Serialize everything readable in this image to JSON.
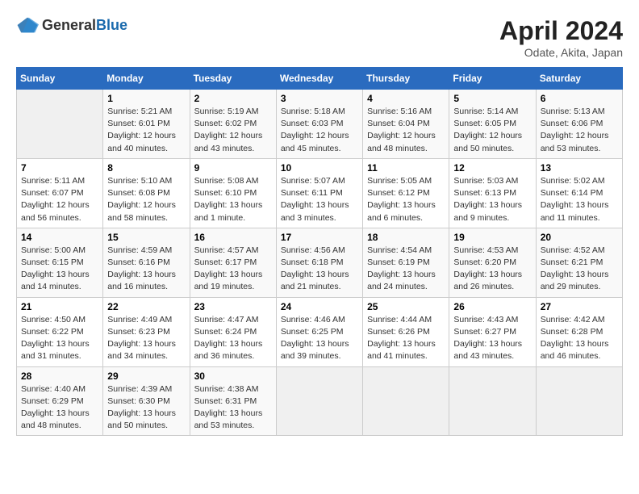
{
  "logo": {
    "text_general": "General",
    "text_blue": "Blue"
  },
  "title": "April 2024",
  "subtitle": "Odate, Akita, Japan",
  "days_of_week": [
    "Sunday",
    "Monday",
    "Tuesday",
    "Wednesday",
    "Thursday",
    "Friday",
    "Saturday"
  ],
  "weeks": [
    [
      {
        "day": "",
        "empty": true
      },
      {
        "day": "1",
        "sunrise": "5:21 AM",
        "sunset": "6:01 PM",
        "daylight": "12 hours and 40 minutes."
      },
      {
        "day": "2",
        "sunrise": "5:19 AM",
        "sunset": "6:02 PM",
        "daylight": "12 hours and 43 minutes."
      },
      {
        "day": "3",
        "sunrise": "5:18 AM",
        "sunset": "6:03 PM",
        "daylight": "12 hours and 45 minutes."
      },
      {
        "day": "4",
        "sunrise": "5:16 AM",
        "sunset": "6:04 PM",
        "daylight": "12 hours and 48 minutes."
      },
      {
        "day": "5",
        "sunrise": "5:14 AM",
        "sunset": "6:05 PM",
        "daylight": "12 hours and 50 minutes."
      },
      {
        "day": "6",
        "sunrise": "5:13 AM",
        "sunset": "6:06 PM",
        "daylight": "12 hours and 53 minutes."
      }
    ],
    [
      {
        "day": "7",
        "sunrise": "5:11 AM",
        "sunset": "6:07 PM",
        "daylight": "12 hours and 56 minutes."
      },
      {
        "day": "8",
        "sunrise": "5:10 AM",
        "sunset": "6:08 PM",
        "daylight": "12 hours and 58 minutes."
      },
      {
        "day": "9",
        "sunrise": "5:08 AM",
        "sunset": "6:10 PM",
        "daylight": "13 hours and 1 minute."
      },
      {
        "day": "10",
        "sunrise": "5:07 AM",
        "sunset": "6:11 PM",
        "daylight": "13 hours and 3 minutes."
      },
      {
        "day": "11",
        "sunrise": "5:05 AM",
        "sunset": "6:12 PM",
        "daylight": "13 hours and 6 minutes."
      },
      {
        "day": "12",
        "sunrise": "5:03 AM",
        "sunset": "6:13 PM",
        "daylight": "13 hours and 9 minutes."
      },
      {
        "day": "13",
        "sunrise": "5:02 AM",
        "sunset": "6:14 PM",
        "daylight": "13 hours and 11 minutes."
      }
    ],
    [
      {
        "day": "14",
        "sunrise": "5:00 AM",
        "sunset": "6:15 PM",
        "daylight": "13 hours and 14 minutes."
      },
      {
        "day": "15",
        "sunrise": "4:59 AM",
        "sunset": "6:16 PM",
        "daylight": "13 hours and 16 minutes."
      },
      {
        "day": "16",
        "sunrise": "4:57 AM",
        "sunset": "6:17 PM",
        "daylight": "13 hours and 19 minutes."
      },
      {
        "day": "17",
        "sunrise": "4:56 AM",
        "sunset": "6:18 PM",
        "daylight": "13 hours and 21 minutes."
      },
      {
        "day": "18",
        "sunrise": "4:54 AM",
        "sunset": "6:19 PM",
        "daylight": "13 hours and 24 minutes."
      },
      {
        "day": "19",
        "sunrise": "4:53 AM",
        "sunset": "6:20 PM",
        "daylight": "13 hours and 26 minutes."
      },
      {
        "day": "20",
        "sunrise": "4:52 AM",
        "sunset": "6:21 PM",
        "daylight": "13 hours and 29 minutes."
      }
    ],
    [
      {
        "day": "21",
        "sunrise": "4:50 AM",
        "sunset": "6:22 PM",
        "daylight": "13 hours and 31 minutes."
      },
      {
        "day": "22",
        "sunrise": "4:49 AM",
        "sunset": "6:23 PM",
        "daylight": "13 hours and 34 minutes."
      },
      {
        "day": "23",
        "sunrise": "4:47 AM",
        "sunset": "6:24 PM",
        "daylight": "13 hours and 36 minutes."
      },
      {
        "day": "24",
        "sunrise": "4:46 AM",
        "sunset": "6:25 PM",
        "daylight": "13 hours and 39 minutes."
      },
      {
        "day": "25",
        "sunrise": "4:44 AM",
        "sunset": "6:26 PM",
        "daylight": "13 hours and 41 minutes."
      },
      {
        "day": "26",
        "sunrise": "4:43 AM",
        "sunset": "6:27 PM",
        "daylight": "13 hours and 43 minutes."
      },
      {
        "day": "27",
        "sunrise": "4:42 AM",
        "sunset": "6:28 PM",
        "daylight": "13 hours and 46 minutes."
      }
    ],
    [
      {
        "day": "28",
        "sunrise": "4:40 AM",
        "sunset": "6:29 PM",
        "daylight": "13 hours and 48 minutes."
      },
      {
        "day": "29",
        "sunrise": "4:39 AM",
        "sunset": "6:30 PM",
        "daylight": "13 hours and 50 minutes."
      },
      {
        "day": "30",
        "sunrise": "4:38 AM",
        "sunset": "6:31 PM",
        "daylight": "13 hours and 53 minutes."
      },
      {
        "day": "",
        "empty": true
      },
      {
        "day": "",
        "empty": true
      },
      {
        "day": "",
        "empty": true
      },
      {
        "day": "",
        "empty": true
      }
    ]
  ]
}
